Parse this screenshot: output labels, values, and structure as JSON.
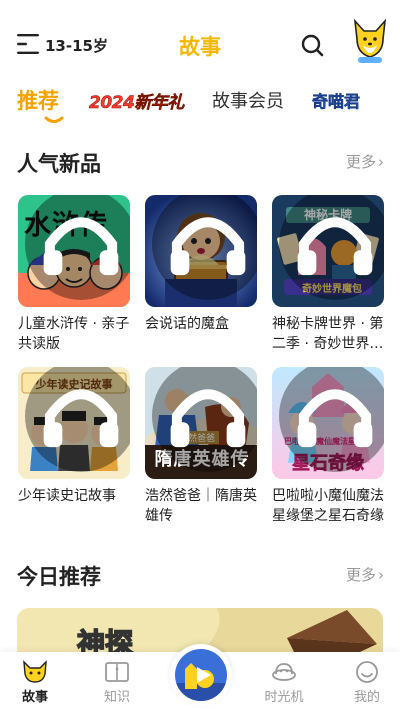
{
  "header": {
    "age_label": "13-15岁",
    "title": "故事"
  },
  "tabs": [
    {
      "label": "推荐",
      "active": true
    },
    {
      "label": "2024新年礼",
      "type": "badge"
    },
    {
      "label": "故事会员"
    },
    {
      "label": "奇喵君",
      "type": "badge"
    }
  ],
  "sections": {
    "popular": {
      "title": "人气新品",
      "more": "更多"
    },
    "today": {
      "title": "今日推荐",
      "more": "更多"
    }
  },
  "cards": [
    {
      "title": "儿童水浒传 · 亲子共读版",
      "cover_text": "水浒传"
    },
    {
      "title": "会说话的魔盒",
      "cover_text": ""
    },
    {
      "title": "神秘卡牌世界 · 第二季 · 奇妙世界魔包",
      "cover_text": "神秘卡牌",
      "cover_text2": "奇妙世界魔包"
    },
    {
      "title": "少年读史记故事",
      "cover_text": "少年读史记故事"
    },
    {
      "title": "浩然爸爸｜隋唐英雄传",
      "cover_text": "隋唐英雄传",
      "cover_tag": "浩然爸爸"
    },
    {
      "title": "巴啦啦小魔仙魔法星缘堡之星石奇缘",
      "cover_text": "星石奇缘",
      "cover_text2": "巴啦啦小魔仙魔法星缘堡"
    }
  ],
  "banner": {
    "text": "神探"
  },
  "bottom_nav": [
    {
      "label": "故事",
      "active": true,
      "icon": "fox-icon"
    },
    {
      "label": "知识",
      "icon": "book-icon"
    },
    {
      "label": "时光机",
      "icon": "time-machine-icon"
    },
    {
      "label": "我的",
      "icon": "smile-icon"
    }
  ],
  "colors": {
    "accent": "#f5b700",
    "muted": "#9a9a9a"
  }
}
